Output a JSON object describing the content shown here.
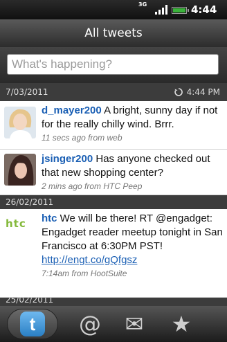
{
  "status": {
    "network": "3G",
    "time": "4:44",
    "ampm": "PM"
  },
  "title": "All tweets",
  "compose": {
    "placeholder": "What's happening?"
  },
  "sections": [
    {
      "date": "7/03/2011",
      "refresh_time": "4:44 PM"
    },
    {
      "date": "26/02/2011"
    },
    {
      "date": "25/02/2011"
    }
  ],
  "tweets": [
    {
      "user": "d_mayer200",
      "text": " A bright, sunny day if not for the really chilly wind. Brrr.",
      "meta": "11 secs ago from web"
    },
    {
      "user": "jsinger200",
      "text": " Has anyone checked out that new shopping center?",
      "meta": "2 mins ago from   HTC Peep"
    },
    {
      "user": "htc",
      "text_before": " We will be there! RT @engadget: Engadget reader meetup tonight in San Francisco at 6:30PM PST! ",
      "link": "http://engt.co/gQfgsz",
      "meta": "7:14am from HootSuite",
      "logo": "htc"
    }
  ],
  "tabs": [
    {
      "name": "twitter-icon",
      "glyph": "t",
      "active": true
    },
    {
      "name": "mentions-icon",
      "glyph": "@"
    },
    {
      "name": "messages-icon",
      "glyph": "✉"
    },
    {
      "name": "favorites-icon",
      "glyph": "★"
    }
  ],
  "colors": {
    "username": "#1a5fb4",
    "htc_green": "#84b93b",
    "tab_blue": "#2a7fc4"
  }
}
